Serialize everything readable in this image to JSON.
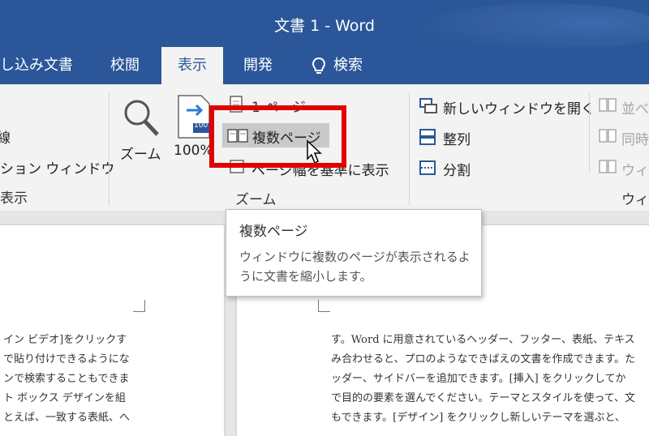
{
  "window": {
    "title": "文書 1  -  Word"
  },
  "tabs": {
    "mailings": "し込み文書",
    "review": "校閲",
    "view": "表示",
    "developer": "開発",
    "search": "検索"
  },
  "ribbon": {
    "left_group": {
      "item1": "線",
      "item2": "ション ウィンドウ",
      "label": "表示"
    },
    "zoom_group": {
      "zoom": "ズーム",
      "zoom100": "100%",
      "one_page": "1 ページ",
      "multiple_pages": "複数ページ",
      "page_width": "ページ幅を基準に表示",
      "label": "ズーム",
      "icon_100_label": "100"
    },
    "window_group": {
      "new_window": "新しいウィンドウを開く",
      "arrange": "整列",
      "split": "分割",
      "side_by_side": "並べ",
      "sync_scroll": "同時",
      "reset_window": "ウィン",
      "label": "ウィン"
    }
  },
  "tooltip": {
    "title": "複数ページ",
    "description": "ウィンドウに複数のページが表示されるように文書を縮小します。"
  },
  "document": {
    "left_page_lines": [
      "イン ビデオ]をクリックす",
      "で貼り付けできるようにな",
      "ンで検索することもできま",
      "ト ボックス デザインを組",
      "とえば、一致する表紙、へ"
    ],
    "right_page_lines": [
      "す。Word に用意されているヘッダー、フッター、表紙、テキス",
      "み合わせると、プロのようなできばえの文書を作成できます。た",
      "ッダー、サイドバーを追加できます。[挿入] をクリックしてか",
      "で目的の要素を選んでください。テーマとスタイルを使って、文",
      "もできます。[デザイン] をクリックし新しいテーマを選ぶと、"
    ]
  },
  "colors": {
    "accent": "#2b579a",
    "highlight_box": "#e00000",
    "ribbon_bg": "#f3f3f3"
  }
}
